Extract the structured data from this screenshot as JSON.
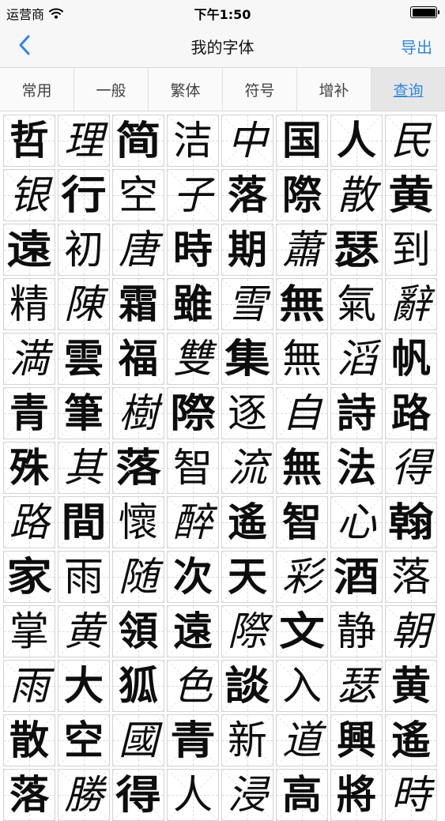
{
  "status_bar": {
    "carrier": "运营商",
    "time": "下午1:50",
    "wifi_icon": "wifi-icon",
    "battery_icon": "battery-icon"
  },
  "nav": {
    "back_icon": "chevron-left-icon",
    "title": "我的字体",
    "export_label": "导出",
    "accent_color": "#2d87e2"
  },
  "tabs": [
    {
      "label": "常用"
    },
    {
      "label": "一般"
    },
    {
      "label": "繁体"
    },
    {
      "label": "符号"
    },
    {
      "label": "增补"
    },
    {
      "label": "查询",
      "active": true
    }
  ],
  "characters": [
    "哲",
    "理",
    "简",
    "洁",
    "中",
    "国",
    "人",
    "民",
    "银",
    "行",
    "空",
    "子",
    "落",
    "際",
    "散",
    "黄",
    "遠",
    "初",
    "唐",
    "時",
    "期",
    "蕭",
    "瑟",
    "到",
    "精",
    "陳",
    "霜",
    "雖",
    "雪",
    "無",
    "氣",
    "辭",
    "満",
    "雲",
    "福",
    "雙",
    "集",
    "無",
    "滔",
    "帆",
    "青",
    "筆",
    "樹",
    "際",
    "逐",
    "自",
    "詩",
    "路",
    "殊",
    "其",
    "落",
    "智",
    "流",
    "無",
    "法",
    "得",
    "路",
    "間",
    "懷",
    "醉",
    "遙",
    "智",
    "心",
    "翰",
    "家",
    "雨",
    "随",
    "次",
    "天",
    "彩",
    "酒",
    "落",
    "掌",
    "黄",
    "領",
    "遠",
    "際",
    "文",
    "静",
    "朝",
    "雨",
    "大",
    "狐",
    "色",
    "談",
    "入",
    "瑟",
    "黄",
    "散",
    "空",
    "國",
    "青",
    "新",
    "道",
    "興",
    "遙",
    "落",
    "勝",
    "得",
    "人",
    "浸",
    "高",
    "將",
    "時"
  ]
}
